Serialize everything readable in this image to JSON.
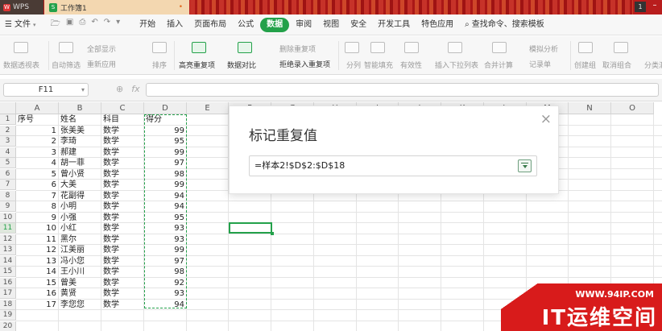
{
  "titlebar": {
    "app_name": "WPS",
    "doc_tab": "工作簿1",
    "doc_tab_marker": "•",
    "window_badge": "1",
    "minimize": "–"
  },
  "menubar": {
    "file": "文件",
    "items": [
      "开始",
      "插入",
      "页面布局",
      "公式",
      "数据",
      "审阅",
      "视图",
      "安全",
      "开发工具",
      "特色应用"
    ],
    "active_item": "数据",
    "search": "查找命令、搜索模板"
  },
  "ribbon": {
    "pivot": "数据透视表",
    "autofilter": "自动筛选",
    "show_all": "全部显示",
    "reapply": "重新应用",
    "sort": "排序",
    "highlight_dup": "高亮重复项",
    "compare": "数据对比",
    "delete_dup": "删除重复项",
    "reject_dup": "拒绝录入重复项",
    "split": "分列",
    "smart_fill": "智能填充",
    "validity": "有效性",
    "dropdown": "插入下拉列表",
    "consolidate": "合并计算",
    "whatif": "模拟分析",
    "record_sheet": "记录单",
    "group": "创建组",
    "ungroup": "取消组合",
    "subtotal": "分类汇"
  },
  "formulabar": {
    "name_box": "F11",
    "fx": "fx",
    "zoom_icon": "⊕",
    "formula": ""
  },
  "grid": {
    "columns": [
      "A",
      "B",
      "C",
      "D",
      "E",
      "F",
      "G",
      "H",
      "I",
      "J",
      "K",
      "L",
      "M",
      "N",
      "O"
    ],
    "rows": [
      "1",
      "2",
      "3",
      "4",
      "5",
      "6",
      "7",
      "8",
      "9",
      "10",
      "11",
      "12",
      "13",
      "14",
      "15",
      "16",
      "17",
      "18",
      "19",
      "20"
    ],
    "selected_row": "11",
    "headers": {
      "a": "序号",
      "b": "姓名",
      "c": "科目",
      "d": "得分"
    },
    "data": [
      {
        "seq": "1",
        "name": "张美美",
        "subject": "数学",
        "score": "99"
      },
      {
        "seq": "2",
        "name": "李琦",
        "subject": "数学",
        "score": "95"
      },
      {
        "seq": "3",
        "name": "郝建",
        "subject": "数学",
        "score": "99"
      },
      {
        "seq": "4",
        "name": "胡一菲",
        "subject": "数学",
        "score": "97"
      },
      {
        "seq": "5",
        "name": "曾小贤",
        "subject": "数学",
        "score": "98"
      },
      {
        "seq": "6",
        "name": "大美",
        "subject": "数学",
        "score": "99"
      },
      {
        "seq": "7",
        "name": "花副得",
        "subject": "数学",
        "score": "94"
      },
      {
        "seq": "8",
        "name": "小明",
        "subject": "数学",
        "score": "94"
      },
      {
        "seq": "9",
        "name": "小强",
        "subject": "数学",
        "score": "95"
      },
      {
        "seq": "10",
        "name": "小红",
        "subject": "数学",
        "score": "93"
      },
      {
        "seq": "11",
        "name": "黑尔",
        "subject": "数学",
        "score": "93"
      },
      {
        "seq": "12",
        "name": "江美丽",
        "subject": "数学",
        "score": "99"
      },
      {
        "seq": "13",
        "name": "冯小您",
        "subject": "数学",
        "score": "97"
      },
      {
        "seq": "14",
        "name": "王小川",
        "subject": "数学",
        "score": "98"
      },
      {
        "seq": "15",
        "name": "曾美",
        "subject": "数学",
        "score": "92"
      },
      {
        "seq": "16",
        "name": "黄贤",
        "subject": "数学",
        "score": "93"
      },
      {
        "seq": "17",
        "name": "李您您",
        "subject": "数学",
        "score": "94"
      }
    ]
  },
  "dialog": {
    "title": "标记重复值",
    "close": "×",
    "range": "=样本2!$D$2:$D$18"
  },
  "watermark": {
    "url": "WWW.94IP.COM",
    "brand": "IT运维空间"
  },
  "colors": {
    "accent": "#23a14a",
    "titlebar": "#b81d1d",
    "watermark": "#d81b1b"
  }
}
